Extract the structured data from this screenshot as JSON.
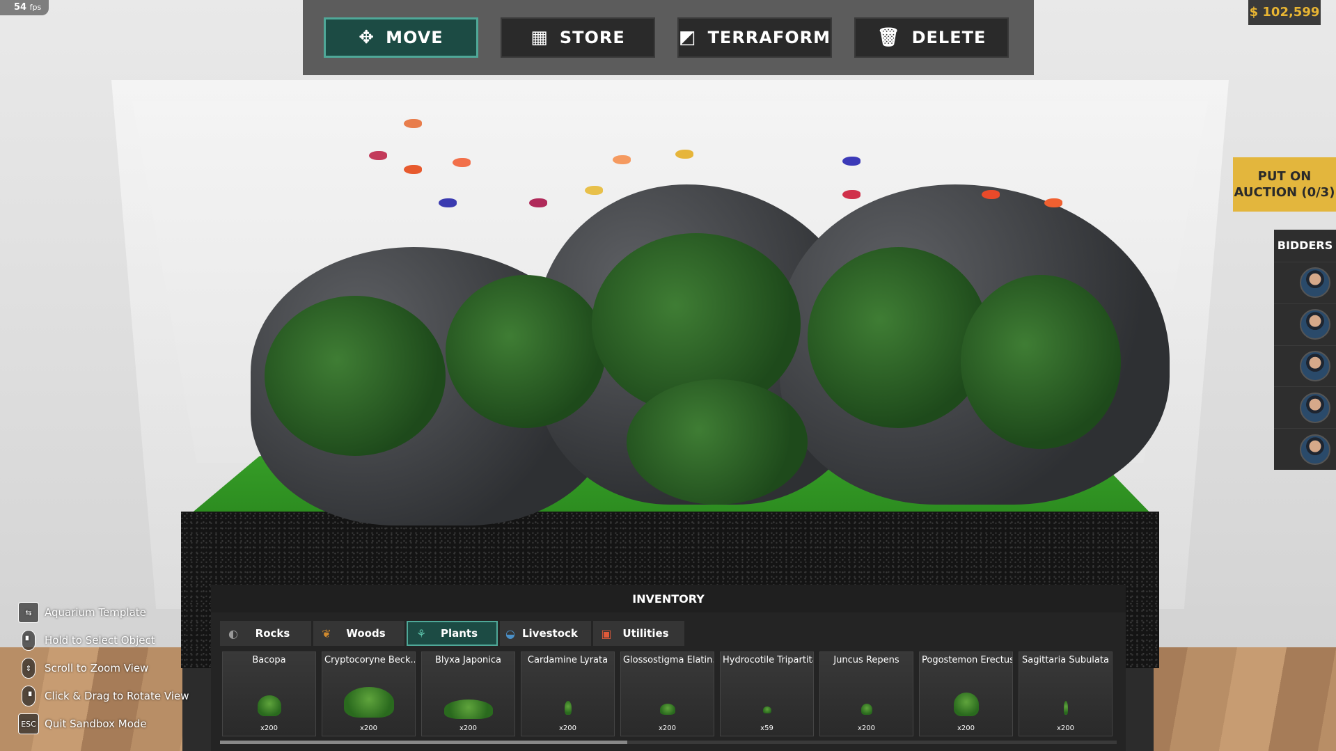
{
  "hud": {
    "fps_value": "54",
    "fps_unit": "fps",
    "money": "$ 102,599"
  },
  "toolbar": [
    {
      "label": "MOVE",
      "icon": "move-icon",
      "active": true
    },
    {
      "label": "STORE",
      "icon": "store-icon",
      "active": false
    },
    {
      "label": "TERRAFORM",
      "icon": "terraform-icon",
      "active": false
    },
    {
      "label": "DELETE",
      "icon": "trash-icon",
      "active": false
    }
  ],
  "auction": {
    "line1": "PUT ON",
    "line2": "AUCTION (0/3)"
  },
  "bidders": {
    "title": "BIDDERS",
    "count": 5
  },
  "hints": [
    {
      "icon": "template-icon",
      "text": "Aquarium Template"
    },
    {
      "icon": "mouse-left-icon",
      "text": "Hold to Select Object"
    },
    {
      "icon": "mouse-scroll-icon",
      "text": "Scroll to Zoom View"
    },
    {
      "icon": "mouse-right-icon",
      "text": "Click & Drag to Rotate View"
    },
    {
      "icon": "esc-key-icon",
      "key": "ESC",
      "text": "Quit Sandbox Mode"
    }
  ],
  "inventory": {
    "title": "INVENTORY",
    "tabs": [
      {
        "label": "Rocks",
        "icon": "rock-icon",
        "icon_color": "#9a9a9a",
        "active": false
      },
      {
        "label": "Woods",
        "icon": "wood-icon",
        "icon_color": "#d08a2e",
        "active": false
      },
      {
        "label": "Plants",
        "icon": "plant-icon",
        "icon_color": "#5bc0a8",
        "active": true
      },
      {
        "label": "Livestock",
        "icon": "fish-icon",
        "icon_color": "#4a90c8",
        "active": false
      },
      {
        "label": "Utilities",
        "icon": "utility-icon",
        "icon_color": "#e05a3a",
        "active": false
      }
    ],
    "items": [
      {
        "name": "Bacopa",
        "qty": "x200"
      },
      {
        "name": "Cryptocoryne Beck...",
        "qty": "x200"
      },
      {
        "name": "Blyxa Japonica",
        "qty": "x200"
      },
      {
        "name": "Cardamine Lyrata",
        "qty": "x200"
      },
      {
        "name": "Glossostigma Elatin...",
        "qty": "x200"
      },
      {
        "name": "Hydrocotile Tripartita",
        "qty": "x59"
      },
      {
        "name": "Juncus Repens",
        "qty": "x200"
      },
      {
        "name": "Pogostemon Erectus",
        "qty": "x200"
      },
      {
        "name": "Sagittaria Subulata",
        "qty": "x200"
      }
    ]
  },
  "colors": {
    "accent": "#4fa898",
    "active_bg": "#1c4b44",
    "money": "#e8b533",
    "auction": "#e3b63d"
  }
}
